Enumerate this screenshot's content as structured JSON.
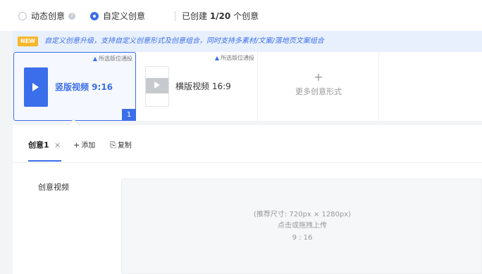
{
  "mode": {
    "option_dynamic": "动态创意",
    "option_custom": "自定义创意",
    "count_prefix": "已创建 ",
    "count_value": "1/20",
    "count_suffix": " 个创意",
    "help_glyph": "?"
  },
  "banner": {
    "badge": "NEW",
    "text": "自定义创意升级，支持自定义创意形式及创意组合，同时支持多素材/文案/落地页文案组合"
  },
  "cards": {
    "tag_text": "所选版位通投",
    "vertical_label": "竖版视频 9:16",
    "horizontal_label": "横版视频 16:9",
    "more_plus": "+",
    "more_label": "更多创意形式",
    "selected_index": "1"
  },
  "tabs": {
    "active_label": "创意1",
    "close_glyph": "×",
    "add_label": "添加",
    "add_glyph": "+",
    "copy_label": "复制",
    "copy_glyph": "⎘"
  },
  "form": {
    "field_label": "创意视频",
    "upload_size_hint": "(推荐尺寸: 720px × 1280px)",
    "upload_action": "点击或拖拽上传",
    "upload_ratio": "9 : 16"
  },
  "colors": {
    "accent": "#3b6eea",
    "badge_new": "#f7b62a"
  }
}
